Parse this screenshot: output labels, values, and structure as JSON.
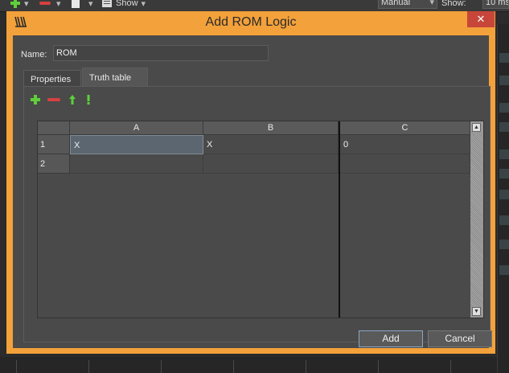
{
  "background": {
    "toolbar": {
      "show_label": "Show",
      "mode_select": "Manual",
      "show_field_label": "Show:",
      "show_field_value": "10 ms"
    }
  },
  "dialog": {
    "title": "Add ROM Logic",
    "close_glyph": "✕",
    "name_label": "Name:",
    "name_value": "ROM",
    "tabs": [
      {
        "label": "Properties",
        "active": false
      },
      {
        "label": "Truth table",
        "active": true
      }
    ],
    "toolbar": {
      "add_row_icon": "plus-icon",
      "remove_row_icon": "minus-icon",
      "move_up_icon": "arrow-up-icon",
      "move_down_icon": "arrow-down-icon"
    },
    "table": {
      "columns": [
        "A",
        "B",
        "C"
      ],
      "rows": [
        {
          "index": "1",
          "cells": [
            "X",
            "X",
            "0"
          ]
        },
        {
          "index": "2",
          "cells": [
            "",
            "",
            ""
          ]
        }
      ]
    },
    "buttons": {
      "add": "Add",
      "cancel": "Cancel"
    }
  },
  "colors": {
    "frame": "#f3a13a",
    "close": "#c7463a",
    "panel": "#4a4a4a",
    "add_green": "#5fcf3a",
    "remove_red": "#d84040"
  }
}
